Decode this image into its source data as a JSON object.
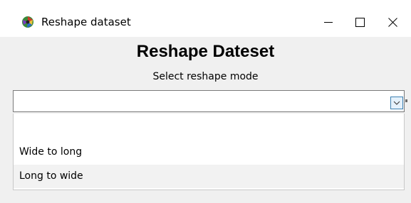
{
  "window": {
    "title": "Reshape dataset",
    "controls": {
      "minimize": "minimize-icon",
      "maximize": "maximize-icon",
      "close": "close-icon"
    }
  },
  "header": {
    "title": "Reshape Dateset",
    "subtitle": "Select reshape mode"
  },
  "combo": {
    "selected_value": "",
    "arrow_icon": "chevron-down-icon"
  },
  "dropdown": {
    "options": [
      {
        "label": ""
      },
      {
        "label": "Wide to long"
      },
      {
        "label": "Long to wide"
      }
    ],
    "highlighted_index": 2
  },
  "colors": {
    "window_bg": "#f0f0f0",
    "titlebar_bg": "#ffffff",
    "arrow_border": "#3c7fb1",
    "highlight_bg": "#f2f2f2"
  }
}
